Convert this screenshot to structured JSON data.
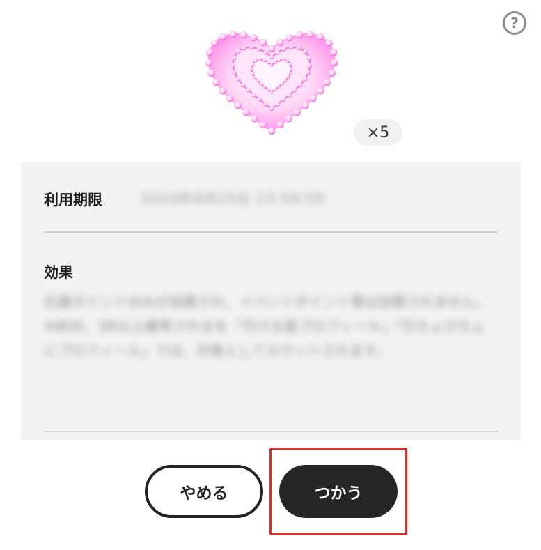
{
  "help": {
    "glyph": "?",
    "icon": "question-circle-icon"
  },
  "item": {
    "icon": "pink-heart-icon",
    "quantity_label": "×5",
    "accent_color": "#ff6fe0"
  },
  "details": {
    "expiry_label": "利用期限",
    "expiry_value": "2024年8月25日 23:59:59",
    "effect_label": "効果",
    "effect_text": "応援ポイントのみが加算され、イベントポイント等は加算されません。\n※BOX、SR以上確率されるを「引ける度プロフィール」「引ちょびちょにプロフィール」では、対象としてカウントされます。"
  },
  "actions": {
    "cancel_label": "やめる",
    "use_label": "つかう",
    "highlight_color": "#d9322b"
  }
}
